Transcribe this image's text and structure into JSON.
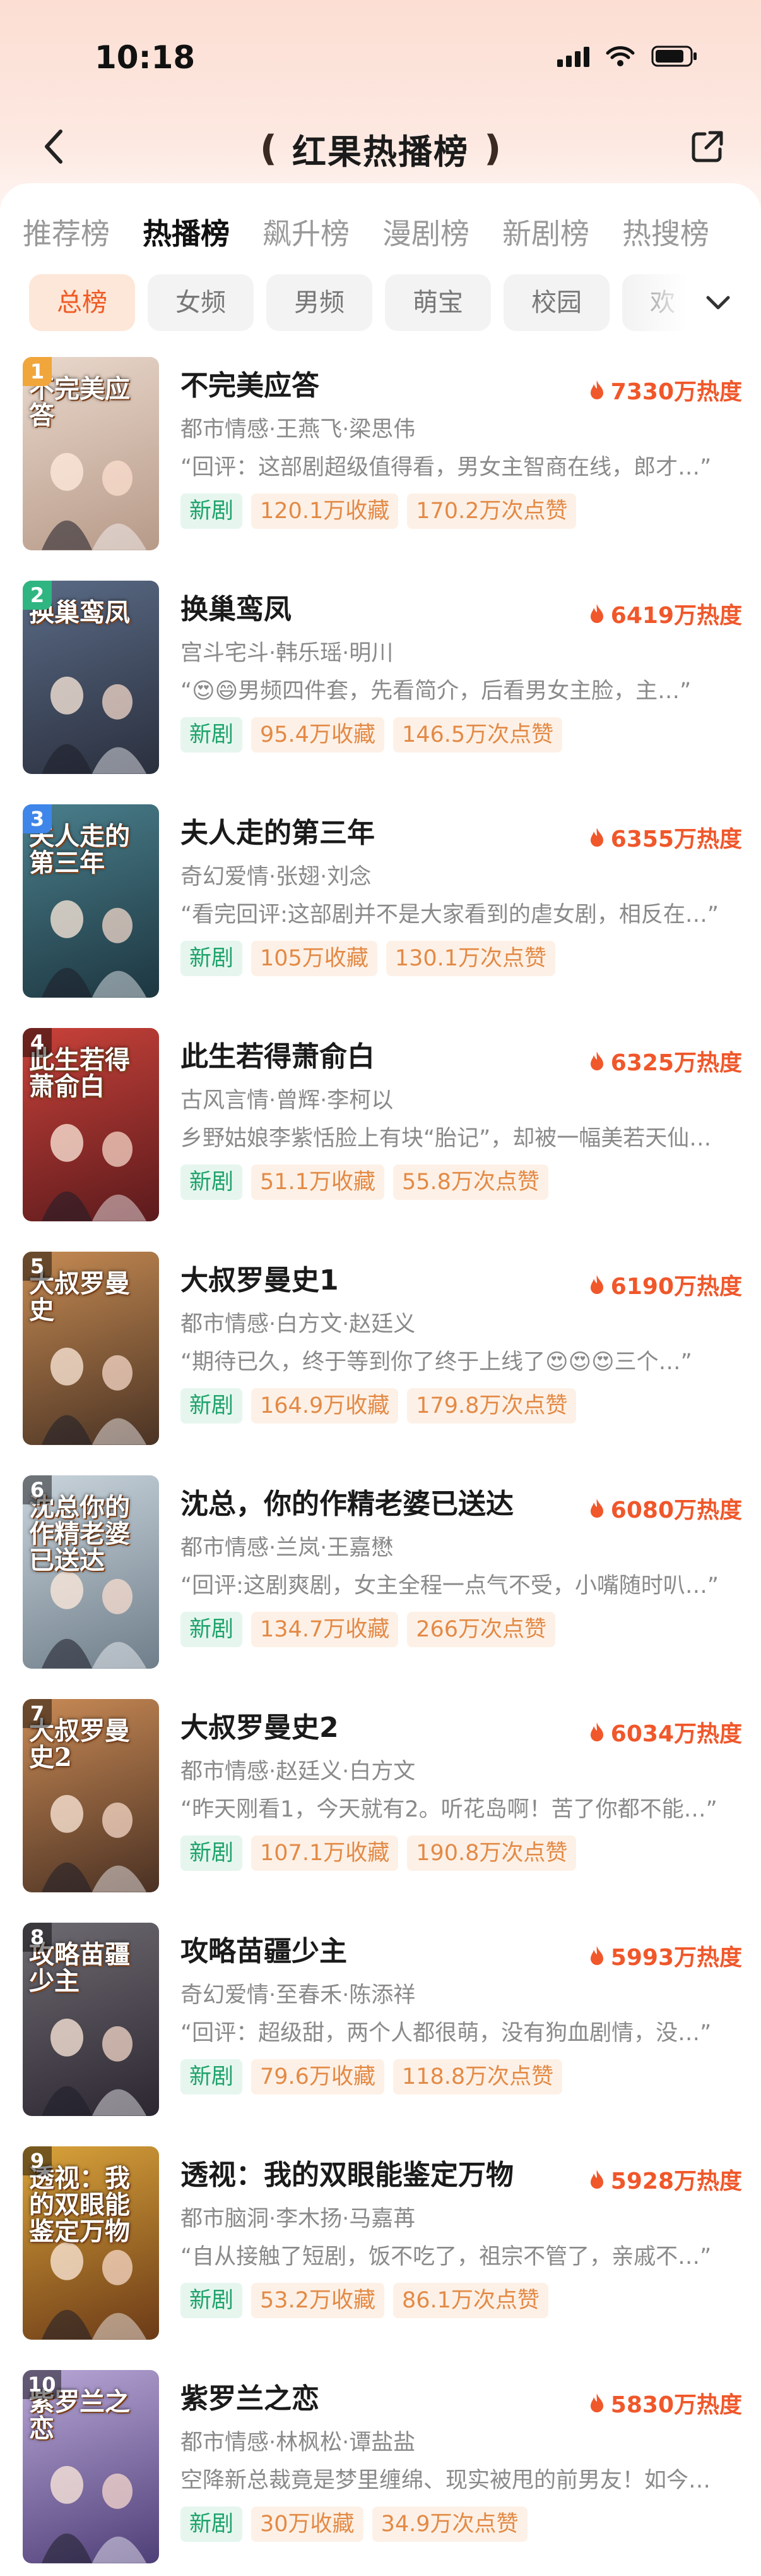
{
  "status_bar": {
    "time": "10:18"
  },
  "nav": {
    "title": "红果热播榜",
    "laurel_left": "❪",
    "laurel_right": "❫"
  },
  "tabs": [
    "推荐榜",
    "热播榜",
    "飙升榜",
    "漫剧榜",
    "新剧榜",
    "热搜榜"
  ],
  "active_tab": "热播榜",
  "filters": [
    "总榜",
    "女频",
    "男频",
    "萌宝",
    "校园",
    "欢"
  ],
  "active_filter": "总榜",
  "colors": {
    "accent": "#f05a24",
    "heat": "#f0572a",
    "new_tag": "#1fa36b",
    "stat_tag": "#e38a46",
    "rank_gold": "#f0a63a",
    "rank_green": "#2fb581",
    "rank_blue": "#3f86ea"
  },
  "items": [
    {
      "rank": "1",
      "title": "不完美应答",
      "heat": "7330万热度",
      "meta": "都市情感·王燕飞·梁思伟",
      "quote": "“回评：这部剧超级值得看，男女主智商在线，郎才…”",
      "tag_new": "新剧",
      "favorites": "120.1万收藏",
      "likes": "170.2万次点赞",
      "poster_text": "不完美应答",
      "poster_bg": [
        "#e9d8cc",
        "#b79a88"
      ]
    },
    {
      "rank": "2",
      "title": "换巢鸾凤",
      "heat": "6419万热度",
      "meta": "宫斗宅斗·韩乐瑶·明川",
      "quote": "“😍😄男频四件套，先看简介，后看男女主脸，主…”",
      "tag_new": "新剧",
      "favorites": "95.4万收藏",
      "likes": "146.5万次点赞",
      "poster_text": "换巢鸾凤",
      "poster_bg": [
        "#5a6b86",
        "#2a2f3d"
      ]
    },
    {
      "rank": "3",
      "title": "夫人走的第三年",
      "heat": "6355万热度",
      "meta": "奇幻爱情·张翅·刘念",
      "quote": "“看完回评:这部剧并不是大家看到的虐女剧，相反在…”",
      "tag_new": "新剧",
      "favorites": "105万收藏",
      "likes": "130.1万次点赞",
      "poster_text": "夫人走的第三年",
      "poster_bg": [
        "#4a7f8c",
        "#1d3640"
      ]
    },
    {
      "rank": "4",
      "title": "此生若得萧俞白",
      "heat": "6325万热度",
      "meta": "古风言情·曾辉·李柯以",
      "quote": "乡野姑娘李紫恬脸上有块“胎记”，却被一幅美若天仙…",
      "tag_new": "新剧",
      "favorites": "51.1万收藏",
      "likes": "55.8万次点赞",
      "poster_text": "此生若得萧俞白",
      "poster_bg": [
        "#c9423a",
        "#5b1a1c"
      ]
    },
    {
      "rank": "5",
      "title": "大叔罗曼史1",
      "heat": "6190万热度",
      "meta": "都市情感·白方文·赵廷义",
      "quote": "“期待已久，终于等到你了终于上线了😍😍😍三个…”",
      "tag_new": "新剧",
      "favorites": "164.9万收藏",
      "likes": "179.8万次点赞",
      "poster_text": "大叔罗曼史",
      "poster_bg": [
        "#c58a52",
        "#4a3324"
      ]
    },
    {
      "rank": "6",
      "title": "沈总，你的作精老婆已送达",
      "heat": "6080万热度",
      "meta": "都市情感·兰岚·王嘉懋",
      "quote": "“回评:这剧爽剧，女主全程一点气不受，小嘴随时叭…”",
      "tag_new": "新剧",
      "favorites": "134.7万收藏",
      "likes": "266万次点赞",
      "poster_text": "沈总你的作精老婆已送达",
      "poster_bg": [
        "#c9d4dc",
        "#6f7e8a"
      ]
    },
    {
      "rank": "7",
      "title": "大叔罗曼史2",
      "heat": "6034万热度",
      "meta": "都市情感·赵廷义·白方文",
      "quote": "“昨天刚看1，今天就有2。听花岛啊！苦了你都不能…”",
      "tag_new": "新剧",
      "favorites": "107.1万收藏",
      "likes": "190.8万次点赞",
      "poster_text": "大叔罗曼史2",
      "poster_bg": [
        "#c98a55",
        "#4a3123"
      ]
    },
    {
      "rank": "8",
      "title": "攻略苗疆少主",
      "heat": "5993万热度",
      "meta": "奇幻爱情·至春禾·陈添祥",
      "quote": "“回评：超级甜，两个人都很萌，没有狗血剧情，没…”",
      "tag_new": "新剧",
      "favorites": "79.6万收藏",
      "likes": "118.8万次点赞",
      "poster_text": "攻略苗疆少主",
      "poster_bg": [
        "#6f6b72",
        "#2b2630"
      ]
    },
    {
      "rank": "9",
      "title": "透视：我的双眼能鉴定万物",
      "heat": "5928万热度",
      "meta": "都市脑洞·李木扬·马嘉苒",
      "quote": "“自从接触了短剧，饭不吃了，祖宗不管了，亲戚不…”",
      "tag_new": "新剧",
      "favorites": "53.2万收藏",
      "likes": "86.1万次点赞",
      "poster_text": "透视：我的双眼能鉴定万物",
      "poster_bg": [
        "#d9a33a",
        "#6b3a17"
      ]
    },
    {
      "rank": "10",
      "title": "紫罗兰之恋",
      "heat": "5830万热度",
      "meta": "都市情感·林枫松·谭盐盐",
      "quote": "空降新总裁竟是梦里缠绵、现实被甩的前男友！如今…",
      "tag_new": "新剧",
      "favorites": "30万收藏",
      "likes": "34.9万次点赞",
      "poster_text": "紫罗兰之恋",
      "poster_bg": [
        "#b8a6d6",
        "#4f3f78"
      ]
    }
  ]
}
